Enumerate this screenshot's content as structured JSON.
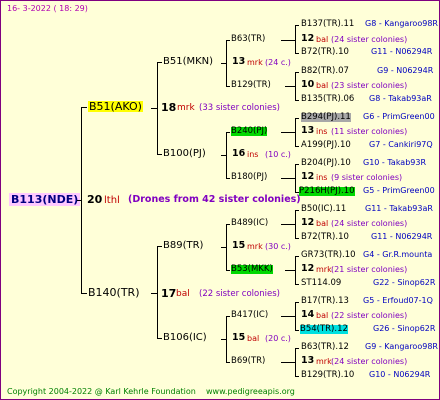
{
  "header": {
    "date": "16-  3-2022 ( 18: 29)"
  },
  "root": {
    "name": "B113(NDE)",
    "number": "20",
    "line": "lthl",
    "note": "(Drones from 42 sister colonies)"
  },
  "gen1": [
    {
      "name": "B51(AKO)",
      "number": "18",
      "line": "mrk",
      "sisters": "(33 sister colonies)"
    },
    {
      "name": "B140(TR)",
      "number": "17",
      "line": "bal",
      "sisters": "(22 sister colonies)"
    }
  ],
  "gen2": [
    {
      "name": "B51(MKN)",
      "number": "13",
      "line": "mrk",
      "sisters": "(24 c.)"
    },
    {
      "name": "B100(PJ)",
      "number": "16",
      "line": "ins",
      "sisters": "(10 c.)"
    },
    {
      "name": "B89(TR)",
      "number": "15",
      "line": "mrk",
      "sisters": "(30 c.)"
    },
    {
      "name": "B106(IC)",
      "number": "15",
      "line": "bal",
      "sisters": "(20 c.)"
    }
  ],
  "gen3": [
    {
      "name": "B63(TR)",
      "number": "13",
      "line": "mrk",
      "sisters": "(24 c.)"
    },
    {
      "name": "B129(TR)",
      "number": "",
      "line": "",
      "sisters": ""
    },
    {
      "name": "B240(PJ)",
      "number": "16",
      "line": "ins",
      "sisters": "(10 c.)"
    },
    {
      "name": "B180(PJ)",
      "number": "",
      "line": "",
      "sisters": ""
    },
    {
      "name": "B489(IC)",
      "number": "15",
      "line": "mrk",
      "sisters": "(30 c.)"
    },
    {
      "name": "B53(MKK)",
      "number": "",
      "line": "",
      "sisters": ""
    },
    {
      "name": "B417(IC)",
      "number": "15",
      "line": "bal",
      "sisters": "(20 c.)"
    },
    {
      "name": "B69(TR)",
      "number": "",
      "line": "",
      "sisters": ""
    }
  ],
  "gen4": [
    {
      "name": "B137(TR).11",
      "cpb": "G8 - Kangaroo98R"
    },
    {
      "number": "12",
      "line": "bal",
      "sisters": "(24 sister colonies)"
    },
    {
      "name": "B72(TR).10",
      "cpb": "G11 - N06294R"
    },
    {
      "name": "B82(TR).07",
      "cpb": "G9 - N06294R"
    },
    {
      "number": "10",
      "line": "bal",
      "sisters": "(23 sister colonies)"
    },
    {
      "name": "B135(TR).06",
      "cpb": "G8 - Takab93aR"
    },
    {
      "name": "B294(PJ).11",
      "cpb": "G6 - PrimGreen00"
    },
    {
      "number": "13",
      "line": "ins",
      "sisters": "(11 sister colonies)"
    },
    {
      "name": "A199(PJ).10",
      "cpb": "G7 - Cankiri97Q"
    },
    {
      "name": "B204(PJ).10",
      "cpb": "G10 - Takab93R"
    },
    {
      "number": "12",
      "line": "ins",
      "sisters": "(9 sister colonies)"
    },
    {
      "name": "P216H(PJ).10",
      "cpb": "G5 - PrimGreen00"
    },
    {
      "name": "B50(IC).11",
      "cpb": "G11 - Takab93aR"
    },
    {
      "number": "12",
      "line": "bal",
      "sisters": "(24 sister colonies)"
    },
    {
      "name": "B72(TR).10",
      "cpb": "G11 - N06294R"
    },
    {
      "name": "GR73(TR).10",
      "cpb": "G4 - Gr.R.mounta"
    },
    {
      "number": "12",
      "line": "mrk",
      "sisters": "(21 sister colonies)"
    },
    {
      "name": "ST114.09",
      "cpb": "G22 - Sinop62R"
    },
    {
      "name": "B17(TR).13",
      "cpb": "G5 - Erfoud07-1Q"
    },
    {
      "number": "14",
      "line": "bal",
      "sisters": "(22 sister colonies)"
    },
    {
      "name": "B54(TR).12",
      "cpb": "G26 - Sinop62R"
    },
    {
      "name": "B63(TR).12",
      "cpb": "G9 - Kangaroo98R"
    },
    {
      "number": "13",
      "line": "mrk",
      "sisters": "(24 sister colonies)"
    },
    {
      "name": "B129(TR).10",
      "cpb": "G10 - N06294R"
    }
  ],
  "footer": {
    "copyright": "Copyright 2004-2022 @ Karl Kehrle Foundation",
    "site": "www.pedigreeapis.org"
  }
}
